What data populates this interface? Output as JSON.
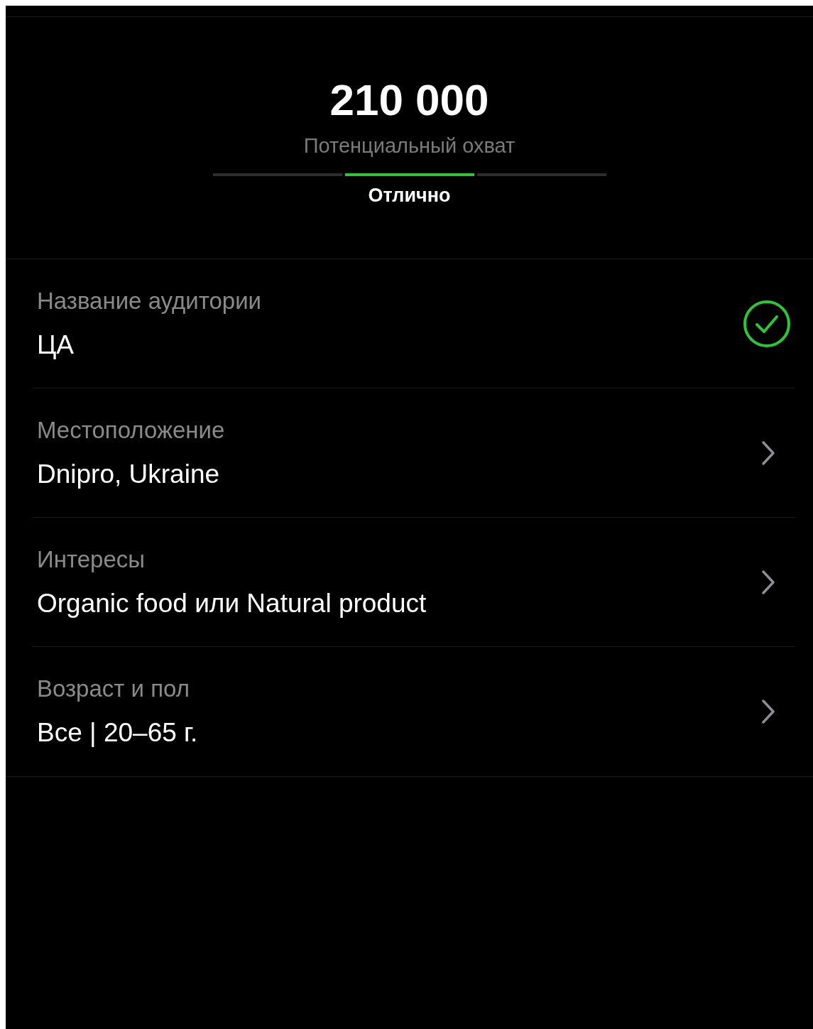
{
  "reach": {
    "value": "210 000",
    "caption": "Потенциальный охват"
  },
  "meter": {
    "segments": [
      {
        "selected": false
      },
      {
        "selected": true
      },
      {
        "selected": false
      }
    ],
    "label": "Отлично"
  },
  "rows": [
    {
      "label": "Название аудитории",
      "value": "ЦА",
      "kind": "check"
    },
    {
      "label": "Местоположение",
      "value": "Dnipro, Ukraine",
      "kind": "chevron"
    },
    {
      "label": "Интересы",
      "value": "Organic food или Natural product",
      "kind": "chevron"
    },
    {
      "label": "Возраст и пол",
      "value": "Все | 20–65 г.",
      "kind": "chevron"
    }
  ]
}
